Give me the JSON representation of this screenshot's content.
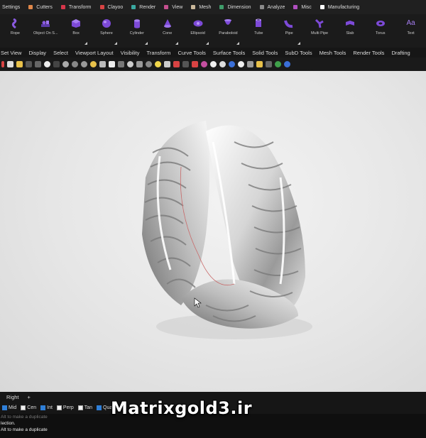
{
  "tabs": [
    {
      "label": "Settings",
      "color": ""
    },
    {
      "label": "Cutters",
      "color": "#e0884a"
    },
    {
      "label": "Transform",
      "color": "#d6364a"
    },
    {
      "label": "Clayoo",
      "color": "#d84343"
    },
    {
      "label": "Render",
      "color": "#3aa8a0"
    },
    {
      "label": "View",
      "color": "#c44f8e"
    },
    {
      "label": "Mesh",
      "color": "#c9b79a"
    },
    {
      "label": "Dimension",
      "color": "#3f9c6a"
    },
    {
      "label": "Analyze",
      "color": "#8a8a8a"
    },
    {
      "label": "Misc",
      "color": "#b04fc0"
    },
    {
      "label": "Manufacturing",
      "color": "#ffffff"
    }
  ],
  "ribbon": [
    {
      "label": "Rope",
      "icon": "rope-icon"
    },
    {
      "label": "Object On S...",
      "icon": "object-on-surface-icon"
    },
    {
      "label": "Box",
      "icon": "box-icon"
    },
    {
      "label": "Sphere",
      "icon": "sphere-icon"
    },
    {
      "label": "Cylinder",
      "icon": "cylinder-icon"
    },
    {
      "label": "Cone",
      "icon": "cone-icon"
    },
    {
      "label": "Ellipsoid",
      "icon": "ellipsoid-icon"
    },
    {
      "label": "Paraboloid",
      "icon": "paraboloid-icon"
    },
    {
      "label": "Tube",
      "icon": "tube-icon"
    },
    {
      "label": "Pipe",
      "icon": "pipe-icon"
    },
    {
      "label": "Multi Pipe",
      "icon": "multi-pipe-icon"
    },
    {
      "label": "Slab",
      "icon": "slab-icon"
    },
    {
      "label": "Torus",
      "icon": "torus-icon"
    },
    {
      "label": "Text",
      "icon": "text-icon",
      "glyph": "Aa"
    }
  ],
  "menu": [
    "Set View",
    "Display",
    "Select",
    "Viewport Layout",
    "Visibility",
    "Transform",
    "Curve Tools",
    "Surface Tools",
    "Solid Tools",
    "SubD Tools",
    "Mesh Tools",
    "Render Tools",
    "Drafting"
  ],
  "viewport": {
    "tab_label": "Right",
    "add_label": "+"
  },
  "osnaps": [
    {
      "label": "Mid",
      "checked": true
    },
    {
      "label": "Cen",
      "checked": false
    },
    {
      "label": "Int",
      "checked": true
    },
    {
      "label": "Perp",
      "checked": false
    },
    {
      "label": "Tan",
      "checked": false
    },
    {
      "label": "Quad",
      "checked": true
    }
  ],
  "command": {
    "lines": [
      "Alt to make a duplicate",
      "lection.",
      "Alt to make a duplicate"
    ]
  },
  "watermark": "Matrixgold3.ir",
  "colors": {
    "accent": "#7d4ad8",
    "checkbox": "#2f7fd8"
  }
}
